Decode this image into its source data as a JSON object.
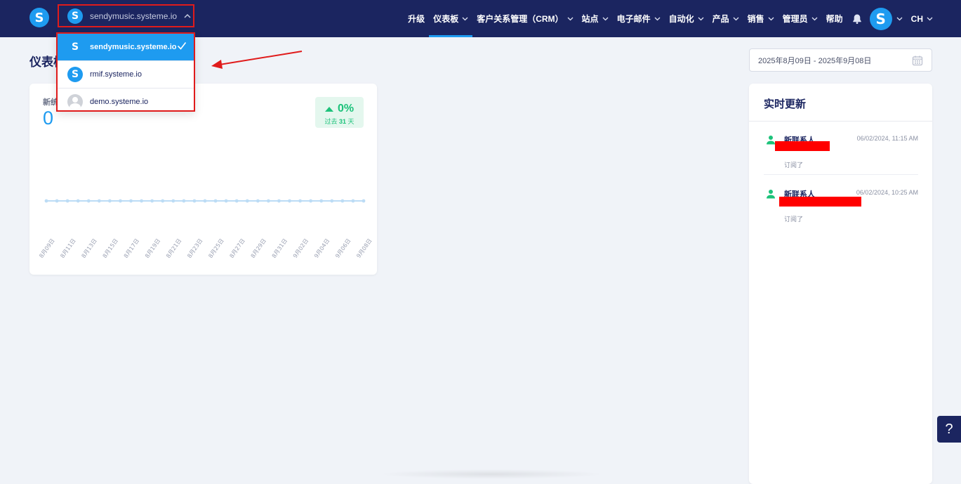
{
  "brand": {
    "logo_letter": "S",
    "color": "#1e9bf0",
    "nav_bg": "#1b2560"
  },
  "workspace": {
    "current": "sendymusic.systeme.io",
    "options": [
      {
        "label": "sendymusic.systeme.io",
        "selected": true,
        "icon": "s-logo-icon"
      },
      {
        "label": "rmif.systeme.io",
        "selected": false,
        "icon": "s-logo-icon"
      },
      {
        "label": "demo.systeme.io",
        "selected": false,
        "icon": "default-avatar-icon"
      }
    ]
  },
  "nav": [
    {
      "label": "升级",
      "dropdown": false,
      "active": false
    },
    {
      "label": "仪表板",
      "dropdown": true,
      "active": true
    },
    {
      "label": "客户关系管理（CRM）",
      "dropdown": true,
      "active": false
    },
    {
      "label": "站点",
      "dropdown": true,
      "active": false
    },
    {
      "label": "电子邮件",
      "dropdown": true,
      "active": false
    },
    {
      "label": "自动化",
      "dropdown": true,
      "active": false
    },
    {
      "label": "产品",
      "dropdown": true,
      "active": false
    },
    {
      "label": "销售",
      "dropdown": true,
      "active": false
    },
    {
      "label": "管理员",
      "dropdown": true,
      "active": false
    },
    {
      "label": "帮助",
      "dropdown": false,
      "active": false
    }
  ],
  "user": {
    "avatar_letter": "S",
    "language": "CH"
  },
  "page": {
    "title": "仪表板"
  },
  "date_range": {
    "value": "2025年8月09日 - 2025年9月08日"
  },
  "stats_card": {
    "label": "新统",
    "value": "0",
    "trend": {
      "percent": "0%",
      "period_prefix": "过去",
      "period_days": "31",
      "period_suffix": "天",
      "color": "#1cc27a"
    }
  },
  "chart_data": {
    "type": "line",
    "x": [
      "8月09日",
      "8月10日",
      "8月11日",
      "8月12日",
      "8月13日",
      "8月14日",
      "8月15日",
      "8月16日",
      "8月17日",
      "8月18日",
      "8月19日",
      "8月20日",
      "8月21日",
      "8月22日",
      "8月23日",
      "8月24日",
      "8月25日",
      "8月26日",
      "8月27日",
      "8月28日",
      "8月29日",
      "8月30日",
      "8月31日",
      "9月01日",
      "9月02日",
      "9月03日",
      "9月04日",
      "9月05日",
      "9月06日",
      "9月07日",
      "9月08日"
    ],
    "tick_labels": [
      "8月09日",
      "8月11日",
      "8月13日",
      "8月15日",
      "8月17日",
      "8月19日",
      "8月21日",
      "8月23日",
      "8月25日",
      "8月27日",
      "8月29日",
      "8月31日",
      "9月02日",
      "9月04日",
      "9月06日",
      "9月08日"
    ],
    "series": [
      {
        "values": [
          0,
          0,
          0,
          0,
          0,
          0,
          0,
          0,
          0,
          0,
          0,
          0,
          0,
          0,
          0,
          0,
          0,
          0,
          0,
          0,
          0,
          0,
          0,
          0,
          0,
          0,
          0,
          0,
          0,
          0,
          0
        ],
        "color": "#bcdcf5"
      }
    ],
    "grid": false
  },
  "updates": {
    "title": "实时更新",
    "items": [
      {
        "title": "新联系人",
        "time": "06/02/2024, 11:15 AM",
        "action": "订阅了"
      },
      {
        "title": "新联系人",
        "time": "06/02/2024, 10:25 AM",
        "action": "订阅了"
      }
    ]
  },
  "help": {
    "label": "?"
  }
}
